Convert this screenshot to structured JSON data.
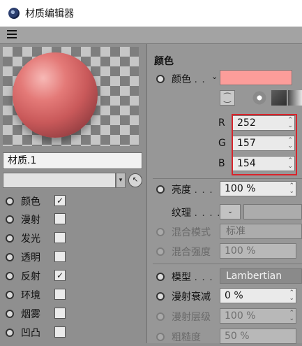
{
  "window": {
    "title": "材质编辑器",
    "app_icon": "cinema4d-icon"
  },
  "menubar": {
    "menu_icon": "hamburger-menu-icon"
  },
  "left": {
    "material_name": "材质.1",
    "channels": [
      {
        "label": "颜色",
        "checked": true,
        "check_glyph": "✓"
      },
      {
        "label": "漫射",
        "checked": false,
        "check_glyph": ""
      },
      {
        "label": "发光",
        "checked": false,
        "check_glyph": ""
      },
      {
        "label": "透明",
        "checked": false,
        "check_glyph": ""
      },
      {
        "label": "反射",
        "checked": true,
        "check_glyph": "✓"
      },
      {
        "label": "环境",
        "checked": false,
        "check_glyph": ""
      },
      {
        "label": "烟雾",
        "checked": false,
        "check_glyph": ""
      },
      {
        "label": "凹凸",
        "checked": false,
        "check_glyph": ""
      }
    ]
  },
  "right": {
    "section_title": "颜色",
    "color_label": "颜色",
    "color_dots": ". .",
    "color_swatch_hex": "#fc9d9a",
    "rgb": [
      {
        "channel": "R",
        "value": "252"
      },
      {
        "channel": "G",
        "value": "157"
      },
      {
        "channel": "B",
        "value": "154"
      }
    ],
    "brightness": {
      "label": "亮度",
      "dots": ". . .",
      "value": "100 %"
    },
    "texture": {
      "label": "纹理",
      "dots": ". . . ."
    },
    "mix_mode": {
      "label": "混合模式",
      "value": "标准"
    },
    "mix_strength": {
      "label": "混合强度",
      "value": "100 %"
    },
    "model": {
      "label": "模型",
      "dots": ". . .",
      "value": "Lambertian"
    },
    "diffuse_falloff": {
      "label": "漫射衰减",
      "value": "0 %"
    },
    "diffuse_level": {
      "label": "漫射层级",
      "value": "100 %"
    },
    "roughness": {
      "label": "粗糙度",
      "value": "50 %"
    }
  },
  "colors": {
    "highlight": "#d9232b",
    "panel_bg": "#979797",
    "swatch": "#fc9d9a"
  }
}
